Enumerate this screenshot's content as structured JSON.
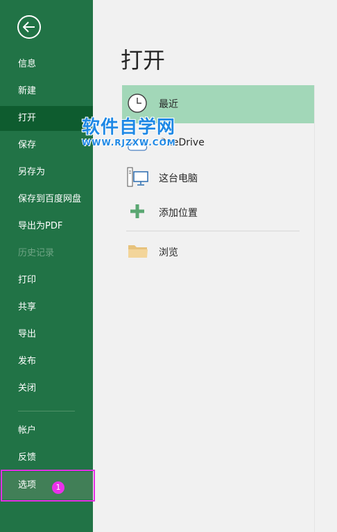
{
  "sidebar": {
    "items": [
      {
        "label": "信息"
      },
      {
        "label": "新建"
      },
      {
        "label": "打开"
      },
      {
        "label": "保存"
      },
      {
        "label": "另存为"
      },
      {
        "label": "保存到百度网盘"
      },
      {
        "label": "导出为PDF"
      },
      {
        "label": "历史记录"
      },
      {
        "label": "打印"
      },
      {
        "label": "共享"
      },
      {
        "label": "导出"
      },
      {
        "label": "发布"
      },
      {
        "label": "关闭"
      },
      {
        "label": "帐户"
      },
      {
        "label": "反馈"
      },
      {
        "label": "选项"
      }
    ],
    "badge": "1"
  },
  "main": {
    "title": "打开",
    "locations": [
      {
        "label": "最近",
        "icon": "clock-icon"
      },
      {
        "label": "OneDrive",
        "icon": "cloud-icon"
      },
      {
        "label": "这台电脑",
        "icon": "computer-icon"
      },
      {
        "label": "添加位置",
        "icon": "plus-icon"
      },
      {
        "label": "浏览",
        "icon": "folder-icon"
      }
    ]
  },
  "watermark": {
    "main": "软件自学网",
    "sub": "WWW.RJZXW.COM"
  },
  "colors": {
    "sidebar_bg": "#217346",
    "active_item": "#0e5c2f",
    "recent_highlight": "#a2d7b8",
    "annotation": "#e52fe5"
  }
}
